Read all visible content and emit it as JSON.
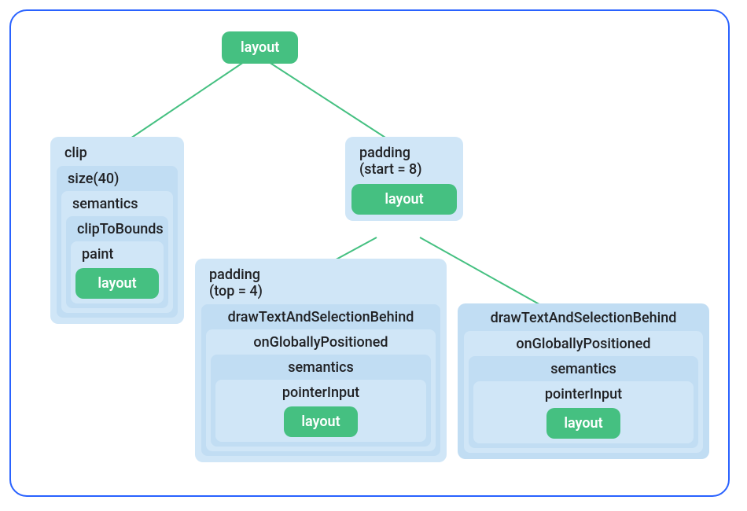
{
  "root": {
    "label": "layout"
  },
  "leftBox": {
    "label": "clip",
    "n1": {
      "label": "size(40)",
      "n2": {
        "label": "semantics",
        "n3": {
          "label": "clipToBounds",
          "n4": {
            "label": "paint",
            "leaf": "layout"
          }
        }
      }
    }
  },
  "rightBox": {
    "label1": "padding",
    "label2": "(start = 8)",
    "leaf": "layout"
  },
  "bottomLeft": {
    "label1": "padding",
    "label2": "(top = 4)",
    "n1": {
      "label": "drawTextAndSelectionBehind",
      "n2": {
        "label": "onGloballyPositioned",
        "n3": {
          "label": "semantics",
          "n4": {
            "label": "pointerInput",
            "leaf": "layout"
          }
        }
      }
    }
  },
  "bottomRight": {
    "n1": {
      "label": "drawTextAndSelectionBehind",
      "n2": {
        "label": "onGloballyPositioned",
        "n3": {
          "label": "semantics",
          "n4": {
            "label": "pointerInput",
            "leaf": "layout"
          }
        }
      }
    }
  },
  "colors": {
    "green": "#45c081",
    "lightBlue": "#d0e6f7",
    "midBlue": "#c1ddf3",
    "borderBlue": "#2962ff"
  }
}
